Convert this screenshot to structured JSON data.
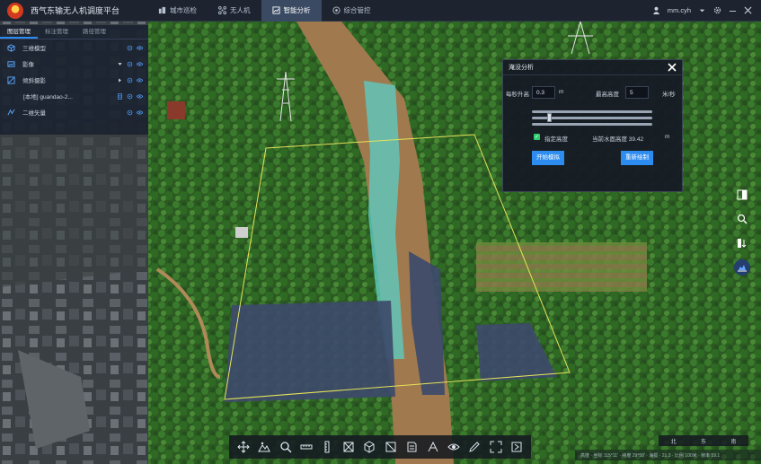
{
  "app": {
    "title": "西气东输无人机调度平台"
  },
  "nav": {
    "tabs": [
      {
        "label": "城市巡检",
        "icon": "city-icon",
        "active": false
      },
      {
        "label": "无人机",
        "icon": "drone-icon",
        "active": false
      },
      {
        "label": "智能分析",
        "icon": "analysis-icon",
        "active": true
      },
      {
        "label": "综合管控",
        "icon": "control-icon",
        "active": false
      }
    ]
  },
  "user": {
    "name": "mm.cyh"
  },
  "layers": {
    "tabs": [
      {
        "label": "图层管理",
        "active": true
      },
      {
        "label": "标注管理",
        "active": false
      },
      {
        "label": "路径管理",
        "active": false
      }
    ],
    "items": [
      {
        "name": "三维模型",
        "icon": "cube-icon"
      },
      {
        "name": "影像",
        "icon": "image-icon"
      },
      {
        "name": "倾斜摄影",
        "icon": "oblique-icon"
      },
      {
        "name": "[本地] guandao-2...",
        "icon": ""
      },
      {
        "name": "二维矢量",
        "icon": "vector-icon"
      }
    ]
  },
  "analysis_panel": {
    "title": "淹没分析",
    "field1_label": "每秒升高",
    "field1_value": "0.3",
    "field1_unit": "m",
    "field2_label": "最高高度",
    "field2_value": "5",
    "field2_unit": "米/秒",
    "checkbox_label": "指定高度",
    "height_readout": "当前水面高度 39.42",
    "height_unit": "m",
    "start_button": "开始模拟",
    "reset_button": "重新绘制",
    "slider_fraction": 0.13
  },
  "right_toolbar": {
    "items": [
      "layers-compare-icon",
      "search-location-icon",
      "split-screen-icon",
      "flood-icon"
    ]
  },
  "bottom_toolbar": {
    "items": [
      "move-icon",
      "terrain-icon",
      "search-icon",
      "measure-distance-icon",
      "measure-height-icon",
      "area-icon",
      "volume-icon",
      "section-icon",
      "profile-icon",
      "slope-icon",
      "viewshed-icon",
      "draw-icon",
      "fullscreen-icon",
      "exit-icon"
    ]
  },
  "map_nav": {
    "north": "北",
    "east": "东",
    "south": "南"
  },
  "status": {
    "text": "高度 · 坐标 115°11' · 纬度 29°58' · 海拔 · 21.3 · 比例 100米 · 帧率 59.1"
  },
  "colors": {
    "accent": "#2d8cf0",
    "topbar": "#1d2430",
    "panel": "#161b24",
    "flood": "#3d4a6a",
    "polygon": "#e6e35a"
  }
}
